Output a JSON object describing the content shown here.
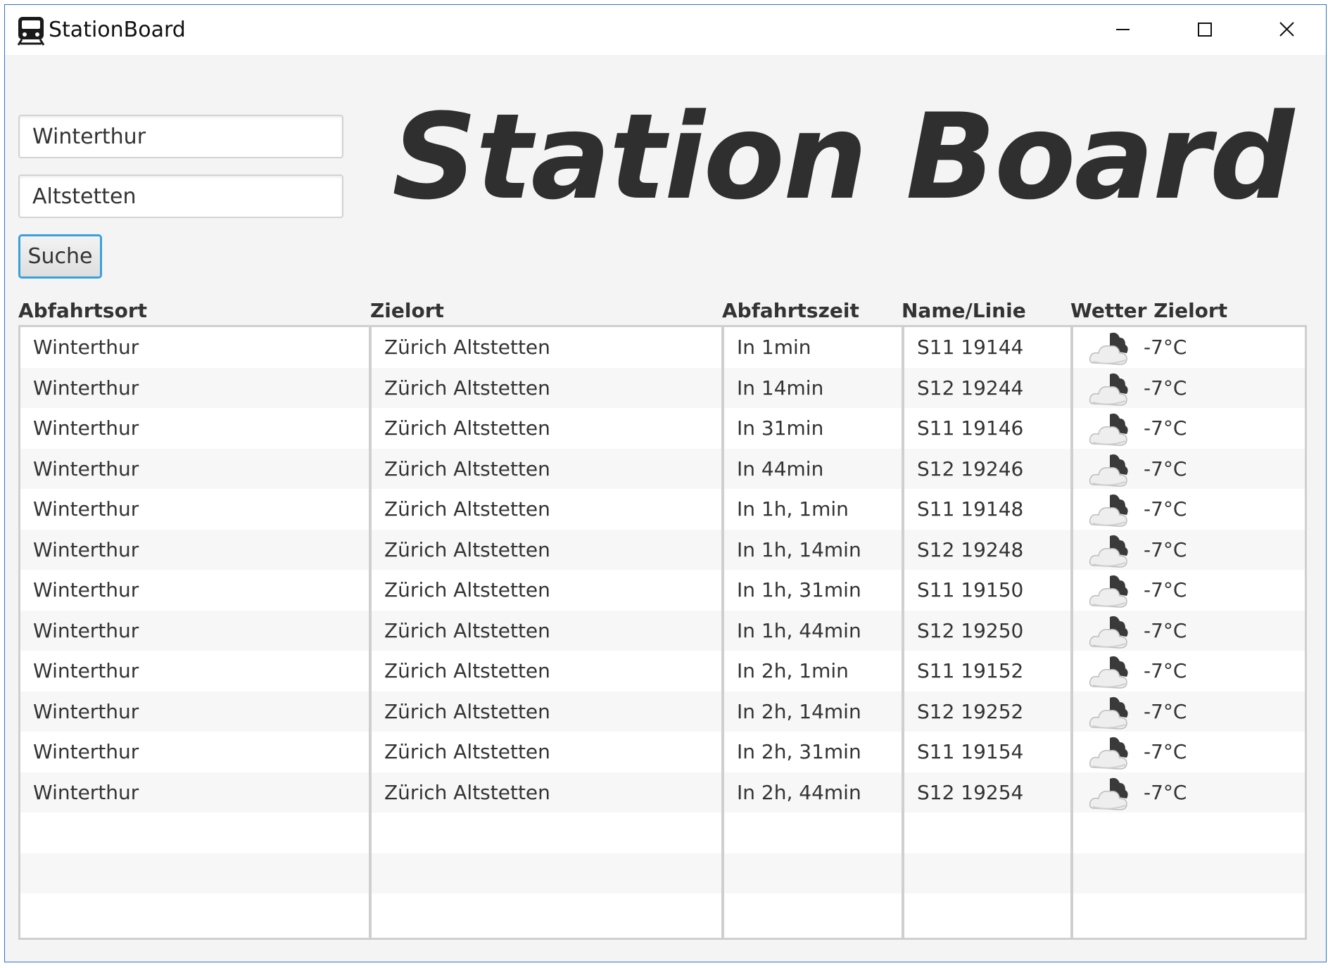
{
  "window": {
    "title": "StationBoard"
  },
  "form": {
    "from_value": "Winterthur",
    "to_value": "Altstetten",
    "search_label": "Suche"
  },
  "banner": {
    "title": "Station Board"
  },
  "table": {
    "headers": {
      "abfahrtsort": "Abfahrtsort",
      "zielort": "Zielort",
      "abfahrtszeit": "Abfahrtszeit",
      "linie": "Name/Linie",
      "wetter": "Wetter Zielort"
    },
    "weather_icon": "cloud-night-icon",
    "rows": [
      {
        "abfahrtsort": "Winterthur",
        "zielort": "Zürich Altstetten",
        "abfahrtszeit": "In 1min",
        "linie": "S11 19144",
        "wetter": "-7°C"
      },
      {
        "abfahrtsort": "Winterthur",
        "zielort": "Zürich Altstetten",
        "abfahrtszeit": "In 14min",
        "linie": "S12 19244",
        "wetter": "-7°C"
      },
      {
        "abfahrtsort": "Winterthur",
        "zielort": "Zürich Altstetten",
        "abfahrtszeit": "In 31min",
        "linie": "S11 19146",
        "wetter": "-7°C"
      },
      {
        "abfahrtsort": "Winterthur",
        "zielort": "Zürich Altstetten",
        "abfahrtszeit": "In 44min",
        "linie": "S12 19246",
        "wetter": "-7°C"
      },
      {
        "abfahrtsort": "Winterthur",
        "zielort": "Zürich Altstetten",
        "abfahrtszeit": "In 1h, 1min",
        "linie": "S11 19148",
        "wetter": "-7°C"
      },
      {
        "abfahrtsort": "Winterthur",
        "zielort": "Zürich Altstetten",
        "abfahrtszeit": "In 1h, 14min",
        "linie": "S12 19248",
        "wetter": "-7°C"
      },
      {
        "abfahrtsort": "Winterthur",
        "zielort": "Zürich Altstetten",
        "abfahrtszeit": "In 1h, 31min",
        "linie": "S11 19150",
        "wetter": "-7°C"
      },
      {
        "abfahrtsort": "Winterthur",
        "zielort": "Zürich Altstetten",
        "abfahrtszeit": "In 1h, 44min",
        "linie": "S12 19250",
        "wetter": "-7°C"
      },
      {
        "abfahrtsort": "Winterthur",
        "zielort": "Zürich Altstetten",
        "abfahrtszeit": "In 2h, 1min",
        "linie": "S11 19152",
        "wetter": "-7°C"
      },
      {
        "abfahrtsort": "Winterthur",
        "zielort": "Zürich Altstetten",
        "abfahrtszeit": "In 2h, 14min",
        "linie": "S12 19252",
        "wetter": "-7°C"
      },
      {
        "abfahrtsort": "Winterthur",
        "zielort": "Zürich Altstetten",
        "abfahrtszeit": "In 2h, 31min",
        "linie": "S11 19154",
        "wetter": "-7°C"
      },
      {
        "abfahrtsort": "Winterthur",
        "zielort": "Zürich Altstetten",
        "abfahrtszeit": "In 2h, 44min",
        "linie": "S12 19254",
        "wetter": "-7°C"
      }
    ]
  }
}
